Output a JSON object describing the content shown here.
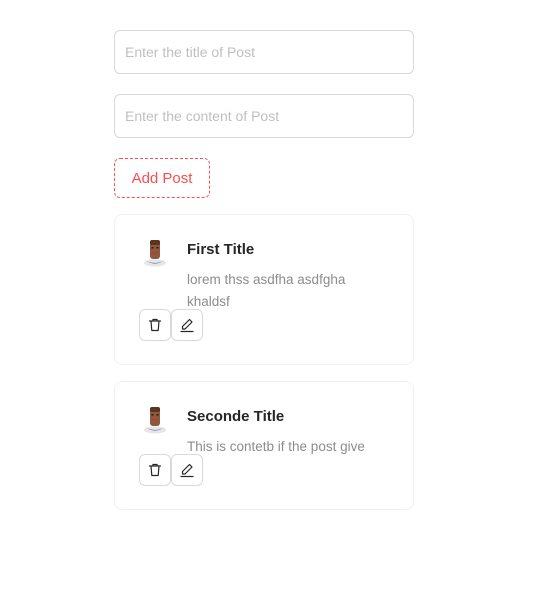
{
  "form": {
    "title_placeholder": "Enter the title of Post",
    "content_placeholder": "Enter the content of Post",
    "add_button_label": "Add Post"
  },
  "posts": [
    {
      "title": "First Title",
      "content": "lorem thss asdfha asdfgha khaldsf"
    },
    {
      "title": "Seconde Title",
      "content": "This is contetb if the post give"
    }
  ],
  "icons": {
    "delete": "trash-icon",
    "edit": "pencil-icon",
    "avatar": "avatar-icon"
  },
  "colors": {
    "accent": "#ff4d4f",
    "avatar_skin": "#8b5a3c",
    "avatar_body": "#3f51b5"
  }
}
